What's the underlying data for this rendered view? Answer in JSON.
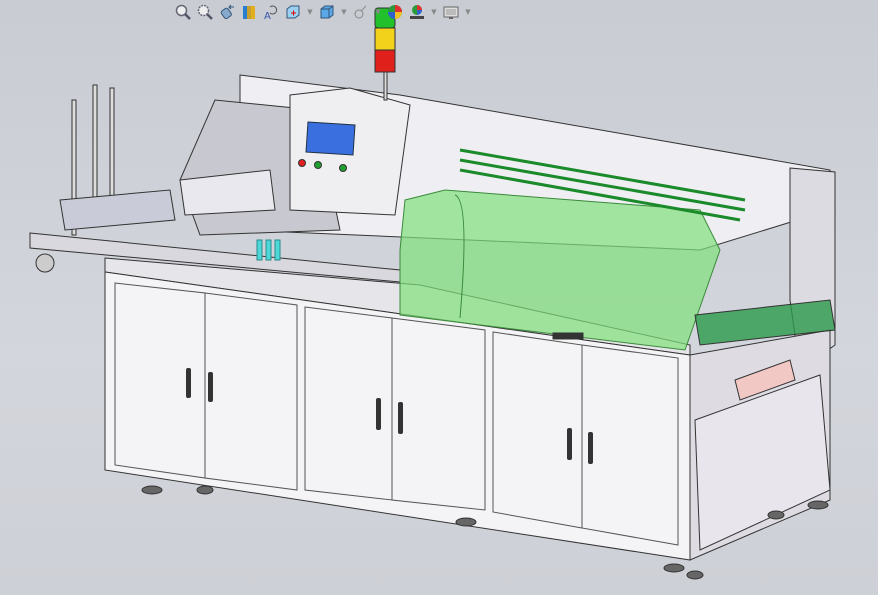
{
  "toolbar": {
    "buttons": [
      {
        "icon": "zoom-to-fit-icon"
      },
      {
        "icon": "zoom-to-area-icon"
      },
      {
        "icon": "previous-view-icon"
      },
      {
        "icon": "section-view-icon"
      },
      {
        "icon": "dynamic-annotation-view-icon"
      },
      {
        "icon": "view-orientation-icon",
        "dropdown": true
      },
      {
        "icon": "display-style-icon",
        "dropdown": true
      },
      {
        "icon": "hide-show-items-icon",
        "dropdown": true
      },
      {
        "icon": "edit-appearance-icon"
      },
      {
        "icon": "apply-scene-icon",
        "dropdown": true
      },
      {
        "icon": "view-settings-icon",
        "dropdown": true
      }
    ]
  },
  "colors": {
    "background": "#cdd0d6",
    "frame": "#eeeef2",
    "guard": "#7fe07a",
    "tower_green": "#22c02a",
    "tower_yellow": "#f2d21a",
    "tower_red": "#e0201a",
    "screen": "#3a6fe0"
  }
}
